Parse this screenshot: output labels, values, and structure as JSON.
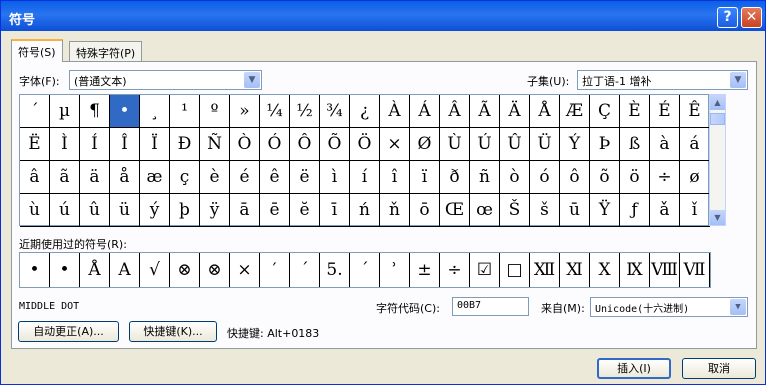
{
  "window": {
    "title": "符号",
    "help_button": "?",
    "close_button": "✕"
  },
  "tabs": [
    {
      "label": "符号(S)"
    },
    {
      "label": "特殊字符(P)"
    }
  ],
  "font": {
    "label": "字体(F):",
    "value": "(普通文本)"
  },
  "subset": {
    "label": "子集(U):",
    "value": "拉丁语-1 增补"
  },
  "symbol_grid": {
    "selected_index": 3,
    "rows": [
      [
        "´",
        "µ",
        "¶",
        "•",
        "¸",
        "¹",
        "º",
        "»",
        "¼",
        "½",
        "¾",
        "¿",
        "À",
        "Á",
        "Â",
        "Ã",
        "Ä",
        "Å",
        "Æ",
        "Ç",
        "È",
        "É",
        "Ê"
      ],
      [
        "Ë",
        "Ì",
        "Í",
        "Î",
        "Ï",
        "Ð",
        "Ñ",
        "Ò",
        "Ó",
        "Ô",
        "Õ",
        "Ö",
        "×",
        "Ø",
        "Ù",
        "Ú",
        "Û",
        "Ü",
        "Ý",
        "Þ",
        "ß",
        "à",
        "á"
      ],
      [
        "â",
        "ã",
        "ä",
        "å",
        "æ",
        "ç",
        "è",
        "é",
        "ê",
        "ë",
        "ì",
        "í",
        "î",
        "ï",
        "ð",
        "ñ",
        "ò",
        "ó",
        "ô",
        "õ",
        "ö",
        "÷",
        "ø"
      ],
      [
        "ù",
        "ú",
        "û",
        "ü",
        "ý",
        "þ",
        "ÿ",
        "ā",
        "ē",
        "ĕ",
        "ī",
        "ń",
        "ň",
        "ō",
        "Œ",
        "œ",
        "Š",
        "š",
        "ū",
        "Ÿ",
        "ƒ",
        "ǎ",
        "ǐ"
      ]
    ]
  },
  "recent": {
    "label": "近期使用过的符号(R):",
    "symbols": [
      "•",
      "•",
      "Å",
      "A",
      "√",
      "⊗",
      "⊗",
      "×",
      "′",
      "΄",
      "5.",
      "΄",
      "ʾ",
      "±",
      "÷",
      "☑",
      "□",
      "Ⅻ",
      "Ⅺ",
      "Ⅹ",
      "Ⅸ",
      "Ⅷ",
      "Ⅶ"
    ]
  },
  "char_name": "MIDDLE DOT",
  "char_code": {
    "label": "字符代码(C):",
    "value": "00B7"
  },
  "from": {
    "label": "来自(M):",
    "value": "Unicode(十六进制)"
  },
  "buttons": {
    "autocorrect": "自动更正(A)...",
    "shortcut_key": "快捷键(K)...",
    "insert": "插入(I)",
    "cancel": "取消"
  },
  "shortcut_text": "快捷键: Alt+0183"
}
